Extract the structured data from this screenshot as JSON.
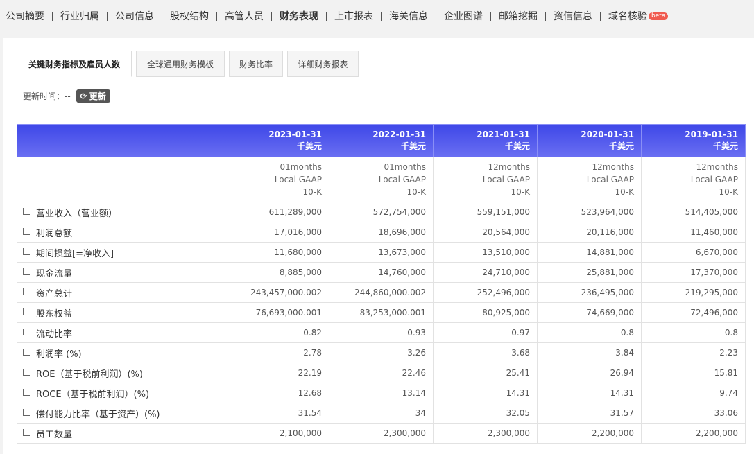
{
  "nav": {
    "items": [
      "公司摘要",
      "行业归属",
      "公司信息",
      "股权结构",
      "高管人员",
      "财务表现",
      "上市报表",
      "海关信息",
      "企业图谱",
      "邮箱挖掘",
      "资信信息",
      "域名核验"
    ],
    "active_index": 5,
    "beta_label": "beta"
  },
  "tabs": [
    "关键财务指标及雇员人数",
    "全球通用财务模板",
    "财务比率",
    "详细财务报表"
  ],
  "update": {
    "label": "更新时间：--",
    "button": "更新"
  },
  "table": {
    "columns": [
      {
        "date": "2023-01-31",
        "unit": "千美元",
        "period": "01months",
        "standard": "Local GAAP",
        "form": "10-K"
      },
      {
        "date": "2022-01-31",
        "unit": "千美元",
        "period": "01months",
        "standard": "Local GAAP",
        "form": "10-K"
      },
      {
        "date": "2021-01-31",
        "unit": "千美元",
        "period": "12months",
        "standard": "Local GAAP",
        "form": "10-K"
      },
      {
        "date": "2020-01-31",
        "unit": "千美元",
        "period": "12months",
        "standard": "Local GAAP",
        "form": "10-K"
      },
      {
        "date": "2019-01-31",
        "unit": "千美元",
        "period": "12months",
        "standard": "Local GAAP",
        "form": "10-K"
      }
    ],
    "rows": [
      {
        "label": "营业收入（营业额）",
        "values": [
          "611,289,000",
          "572,754,000",
          "559,151,000",
          "523,964,000",
          "514,405,000"
        ]
      },
      {
        "label": "利润总额",
        "values": [
          "17,016,000",
          "18,696,000",
          "20,564,000",
          "20,116,000",
          "11,460,000"
        ]
      },
      {
        "label": "期间损益[=净收入]",
        "values": [
          "11,680,000",
          "13,673,000",
          "13,510,000",
          "14,881,000",
          "6,670,000"
        ]
      },
      {
        "label": "现金流量",
        "values": [
          "8,885,000",
          "14,760,000",
          "24,710,000",
          "25,881,000",
          "17,370,000"
        ]
      },
      {
        "label": "资产总计",
        "values": [
          "243,457,000.002",
          "244,860,000.002",
          "252,496,000",
          "236,495,000",
          "219,295,000"
        ]
      },
      {
        "label": "股东权益",
        "values": [
          "76,693,000.001",
          "83,253,000.001",
          "80,925,000",
          "74,669,000",
          "72,496,000"
        ]
      },
      {
        "label": "流动比率",
        "values": [
          "0.82",
          "0.93",
          "0.97",
          "0.8",
          "0.8"
        ]
      },
      {
        "label": "利润率 (%)",
        "values": [
          "2.78",
          "3.26",
          "3.68",
          "3.84",
          "2.23"
        ]
      },
      {
        "label": "ROE（基于税前利润）(%)",
        "values": [
          "22.19",
          "22.46",
          "25.41",
          "26.94",
          "15.81"
        ]
      },
      {
        "label": "ROCE（基于税前利润）(%)",
        "values": [
          "12.68",
          "13.14",
          "14.31",
          "14.31",
          "9.74"
        ]
      },
      {
        "label": "偿付能力比率（基于资产）(%)",
        "values": [
          "31.54",
          "34",
          "32.05",
          "31.57",
          "33.06"
        ]
      },
      {
        "label": "员工数量",
        "values": [
          "2,100,000",
          "2,300,000",
          "2,300,000",
          "2,200,000",
          "2,200,000"
        ]
      }
    ]
  }
}
